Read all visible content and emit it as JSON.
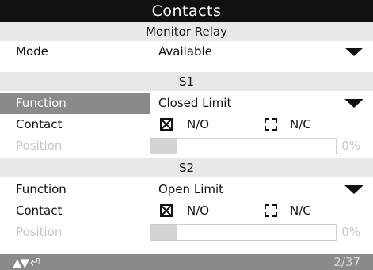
{
  "title": "Contacts",
  "sections": {
    "monitor_relay": "Monitor Relay",
    "s1": "S1",
    "s2": "S2"
  },
  "mode": {
    "label": "Mode",
    "value": "Available"
  },
  "s1": {
    "function_label": "Function",
    "function_value": "Closed Limit",
    "contact_label": "Contact",
    "contact_no": "N/O",
    "contact_nc": "N/C",
    "position_label": "Position",
    "position_value": "0%",
    "position_fraction": 0
  },
  "s2": {
    "function_label": "Function",
    "function_value": "Open Limit",
    "contact_label": "Contact",
    "contact_no": "N/O",
    "contact_nc": "N/C",
    "position_label": "Position",
    "position_value": "0%",
    "position_fraction": 0
  },
  "footer": {
    "nav_glyphs": "▲▼ ⏎",
    "page": "2/37"
  },
  "colors": {
    "title_bg": "#111111",
    "selected_bg": "#8a8a8a",
    "section_bg": "#e8e8e8",
    "disabled_text": "#c6c6c6"
  }
}
